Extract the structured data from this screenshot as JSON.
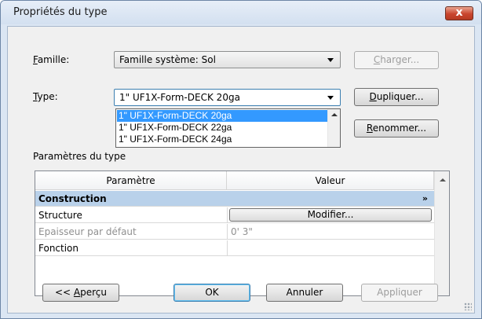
{
  "window": {
    "title": "Propriétés du type",
    "close_label": "x"
  },
  "famille": {
    "label_prefix": "",
    "label_accel": "F",
    "label_rest": "amille:",
    "value": "Famille système: Sol",
    "load_prefix": "",
    "load_accel": "C",
    "load_rest": "harger..."
  },
  "type": {
    "label_accel": "T",
    "label_rest": "ype:",
    "value": "1\" UF1X-Form-DECK 20ga",
    "options": [
      "1\" UF1X-Form-DECK 20ga",
      "1\" UF1X-Form-DECK 22ga",
      "1\" UF1X-Form-DECK 24ga"
    ],
    "duplicate_accel": "D",
    "duplicate_rest": "upliquer...",
    "rename_accel": "R",
    "rename_rest": "enommer..."
  },
  "params": {
    "group_label": "Paramètres du type",
    "col_param": "Paramètre",
    "col_value": "Valeur",
    "category": "Construction",
    "category_toggle": "»",
    "rows": [
      {
        "name": "Structure",
        "value": "Modifier..."
      },
      {
        "name": "Epaisseur par défaut",
        "value": "0'  3\""
      },
      {
        "name": "Fonction",
        "value": ""
      }
    ]
  },
  "footer": {
    "preview_prefix": "<< ",
    "preview_accel": "A",
    "preview_rest": "perçu",
    "ok": "OK",
    "cancel": "Annuler",
    "apply": "Appliquer"
  }
}
